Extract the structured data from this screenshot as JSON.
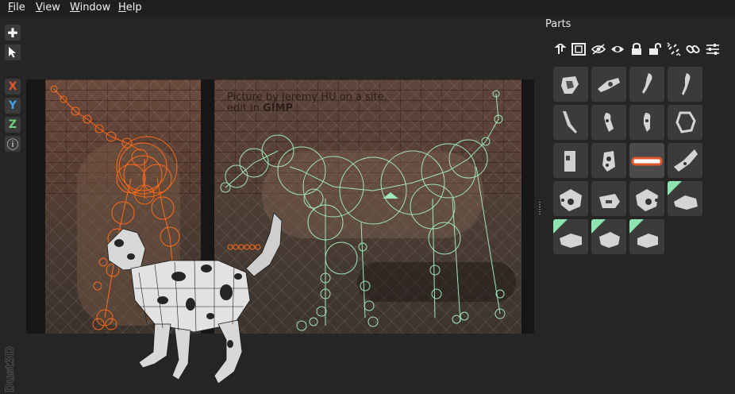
{
  "menu": {
    "file": {
      "first": "F",
      "rest": "ile"
    },
    "view": {
      "first": "V",
      "rest": "iew"
    },
    "window": {
      "first": "W",
      "rest": "indow"
    },
    "help": {
      "first": "H",
      "rest": "elp"
    }
  },
  "toolbar": {
    "add_glyph": "✚",
    "axis_x": "X",
    "axis_y": "Y",
    "axis_z": "Z",
    "info_glyph": "ⓘ"
  },
  "axis_colors": {
    "x": "#e2572a",
    "y": "#3aa0ea",
    "z": "#6bd27a"
  },
  "canvas": {
    "credit_line1": "Picture by Jeremy HU on a site,",
    "credit_line2_prefix": "edit in ",
    "credit_line2_bold": "GIMP"
  },
  "parts_panel": {
    "title": "Parts",
    "tools": [
      "arrow-up-icon",
      "frame-icon",
      "eye-off-icon",
      "eye-icon",
      "lock-icon",
      "unlock-icon",
      "unlink-icon",
      "link-icon",
      "sliders-icon"
    ],
    "parts": [
      {
        "name": "part-1",
        "selected": false,
        "mirrored": false
      },
      {
        "name": "part-2",
        "selected": false,
        "mirrored": false
      },
      {
        "name": "part-3",
        "selected": false,
        "mirrored": false
      },
      {
        "name": "part-4",
        "selected": false,
        "mirrored": false
      },
      {
        "name": "part-5",
        "selected": false,
        "mirrored": false
      },
      {
        "name": "part-6",
        "selected": false,
        "mirrored": false
      },
      {
        "name": "part-7",
        "selected": false,
        "mirrored": false
      },
      {
        "name": "part-8",
        "selected": false,
        "mirrored": false
      },
      {
        "name": "part-9",
        "selected": false,
        "mirrored": false
      },
      {
        "name": "part-10",
        "selected": false,
        "mirrored": false
      },
      {
        "name": "part-11",
        "selected": true,
        "mirrored": false
      },
      {
        "name": "part-12",
        "selected": false,
        "mirrored": false
      },
      {
        "name": "part-13",
        "selected": false,
        "mirrored": false
      },
      {
        "name": "part-14",
        "selected": false,
        "mirrored": false
      },
      {
        "name": "part-15",
        "selected": false,
        "mirrored": false
      },
      {
        "name": "part-16",
        "selected": false,
        "mirrored": true
      },
      {
        "name": "part-17",
        "selected": false,
        "mirrored": true
      },
      {
        "name": "part-18",
        "selected": false,
        "mirrored": true
      },
      {
        "name": "part-19",
        "selected": false,
        "mirrored": true
      }
    ]
  },
  "colors": {
    "node_orange": "#ff6a1a",
    "node_green": "#9fe6b8",
    "mirror_badge": "#8fe3b0",
    "accent": "#e2572a"
  },
  "watermark": "Dust3D"
}
